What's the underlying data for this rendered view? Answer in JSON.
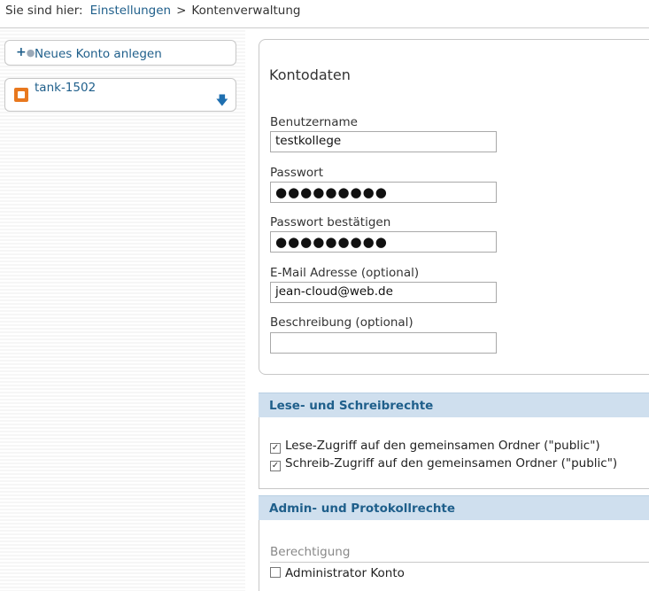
{
  "breadcrumb": {
    "prefix": "Sie sind hier:",
    "link": "Einstellungen",
    "separator": ">",
    "current": "Kontenverwaltung"
  },
  "sidebar": {
    "new_account_icon": "add-user-icon",
    "new_account_label": "Neues Konto anlegen",
    "accounts": [
      {
        "name": "tank-1502",
        "icon": "account-orange-icon",
        "action_icon": "download-arrow-icon"
      }
    ]
  },
  "form": {
    "title": "Kontodaten",
    "username_label": "Benutzername",
    "username_value": "testkollege",
    "password_label": "Passwort",
    "password_value": "●●●●●●●●●",
    "password_confirm_label": "Passwort bestätigen",
    "password_confirm_value": "●●●●●●●●●",
    "email_label": "E-Mail Adresse (optional)",
    "email_value": "jean-cloud@web.de",
    "description_label": "Beschreibung (optional)",
    "description_value": ""
  },
  "rights": {
    "header": "Lese- und Schreibrechte",
    "read_label": "Lese-Zugriff auf den gemeinsamen Ordner (\"public\")",
    "read_checked": true,
    "write_label": "Schreib-Zugriff auf den gemeinsamen Ordner (\"public\")",
    "write_checked": true
  },
  "admin": {
    "header": "Admin- und Protokollrechte",
    "subtitle": "Berechtigung",
    "admin_label": "Administrator Konto",
    "admin_checked": false
  },
  "colors": {
    "link": "#1f5f8b",
    "section_header_bg": "#cfdfee",
    "account_icon": "#e8781e"
  }
}
